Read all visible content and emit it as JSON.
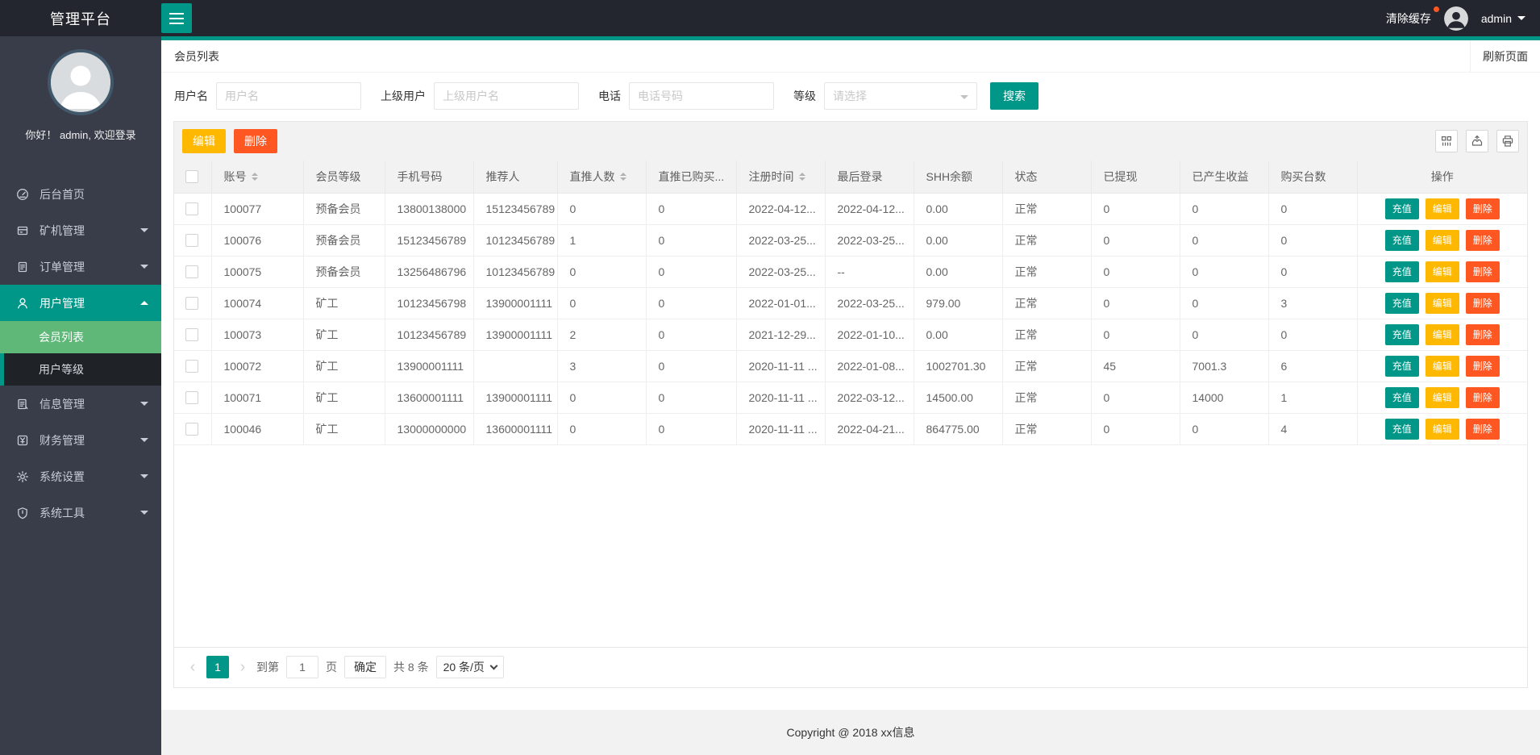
{
  "colors": {
    "accent": "#009688",
    "submenu_green": "#5fb878",
    "warn_yellow": "#ffb800",
    "danger_red": "#ff5722",
    "header_bg": "#23262e",
    "sidebar_bg": "#393d49"
  },
  "header": {
    "app_title": "管理平台",
    "clear_cache": "清除缓存",
    "username": "admin"
  },
  "sidebar": {
    "greeting": "你好！ admin, 欢迎登录",
    "items": [
      {
        "name": "home",
        "label": "后台首页",
        "icon": "dashboard-icon",
        "expandable": false,
        "active": false
      },
      {
        "name": "miner",
        "label": "矿机管理",
        "icon": "miner-icon",
        "expandable": true,
        "active": false
      },
      {
        "name": "order",
        "label": "订单管理",
        "icon": "order-icon",
        "expandable": true,
        "active": false
      },
      {
        "name": "user",
        "label": "用户管理",
        "icon": "user-icon",
        "expandable": true,
        "active": true,
        "children": [
          {
            "name": "member-list",
            "label": "会员列表",
            "active": true
          },
          {
            "name": "user-level",
            "label": "用户等级",
            "active": false
          }
        ]
      },
      {
        "name": "info",
        "label": "信息管理",
        "icon": "info-icon",
        "expandable": true,
        "active": false
      },
      {
        "name": "finance",
        "label": "财务管理",
        "icon": "finance-icon",
        "expandable": true,
        "active": false
      },
      {
        "name": "settings",
        "label": "系统设置",
        "icon": "settings-icon",
        "expandable": true,
        "active": false
      },
      {
        "name": "tools",
        "label": "系统工具",
        "icon": "tools-icon",
        "expandable": true,
        "active": false
      }
    ]
  },
  "page": {
    "title": "会员列表",
    "refresh_label": "刷新页面"
  },
  "filters": {
    "fields": [
      {
        "label": "用户名",
        "placeholder": "用户名"
      },
      {
        "label": "上级用户",
        "placeholder": "上级用户名"
      },
      {
        "label": "电话",
        "placeholder": "电话号码"
      },
      {
        "label": "等级",
        "placeholder": "请选择"
      }
    ],
    "search_label": "搜索"
  },
  "toolbar": {
    "edit_label": "编辑",
    "delete_label": "删除",
    "icons": [
      "columns-icon",
      "export-icon",
      "print-icon"
    ]
  },
  "table": {
    "columns": [
      {
        "label": "账号",
        "sortable": true
      },
      {
        "label": "会员等级",
        "sortable": false
      },
      {
        "label": "手机号码",
        "sortable": false
      },
      {
        "label": "推荐人",
        "sortable": false
      },
      {
        "label": "直推人数",
        "sortable": true
      },
      {
        "label": "直推已购买...",
        "sortable": false
      },
      {
        "label": "注册时间",
        "sortable": true
      },
      {
        "label": "最后登录",
        "sortable": false
      },
      {
        "label": "SHH余额",
        "sortable": false
      },
      {
        "label": "状态",
        "sortable": false
      },
      {
        "label": "已提现",
        "sortable": false
      },
      {
        "label": "已产生收益",
        "sortable": false
      },
      {
        "label": "购买台数",
        "sortable": false
      },
      {
        "label": "操作",
        "sortable": false
      }
    ],
    "rows": [
      [
        "100077",
        "预备会员",
        "13800138000",
        "15123456789",
        "0",
        "0",
        "2022-04-12...",
        "2022-04-12...",
        "0.00",
        "正常",
        "0",
        "0",
        "0"
      ],
      [
        "100076",
        "预备会员",
        "15123456789",
        "10123456789",
        "1",
        "0",
        "2022-03-25...",
        "2022-03-25...",
        "0.00",
        "正常",
        "0",
        "0",
        "0"
      ],
      [
        "100075",
        "预备会员",
        "13256486796",
        "10123456789",
        "0",
        "0",
        "2022-03-25...",
        "--",
        "0.00",
        "正常",
        "0",
        "0",
        "0"
      ],
      [
        "100074",
        "矿工",
        "10123456798",
        "13900001111",
        "0",
        "0",
        "2022-01-01...",
        "2022-03-25...",
        "979.00",
        "正常",
        "0",
        "0",
        "3"
      ],
      [
        "100073",
        "矿工",
        "10123456789",
        "13900001111",
        "2",
        "0",
        "2021-12-29...",
        "2022-01-10...",
        "0.00",
        "正常",
        "0",
        "0",
        "0"
      ],
      [
        "100072",
        "矿工",
        "13900001111",
        "",
        "3",
        "0",
        "2020-11-11 ...",
        "2022-01-08...",
        "1002701.30",
        "正常",
        "45",
        "7001.3",
        "6"
      ],
      [
        "100071",
        "矿工",
        "13600001111",
        "13900001111",
        "0",
        "0",
        "2020-11-11 ...",
        "2022-03-12...",
        "14500.00",
        "正常",
        "0",
        "14000",
        "1"
      ],
      [
        "100046",
        "矿工",
        "13000000000",
        "13600001111",
        "0",
        "0",
        "2020-11-11 ...",
        "2022-04-21...",
        "864775.00",
        "正常",
        "0",
        "0",
        "4"
      ]
    ],
    "row_actions": [
      "充值",
      "编辑",
      "删除"
    ]
  },
  "pagination": {
    "prev": "‹",
    "page": "1",
    "next": "›",
    "goto_label": "到第",
    "goto_value": "1",
    "page_label": "页",
    "confirm_label": "确定",
    "total_label": "共 8 条",
    "page_size": "20 条/页"
  },
  "footer": {
    "copyright": "Copyright @ 2018 xx信息"
  }
}
